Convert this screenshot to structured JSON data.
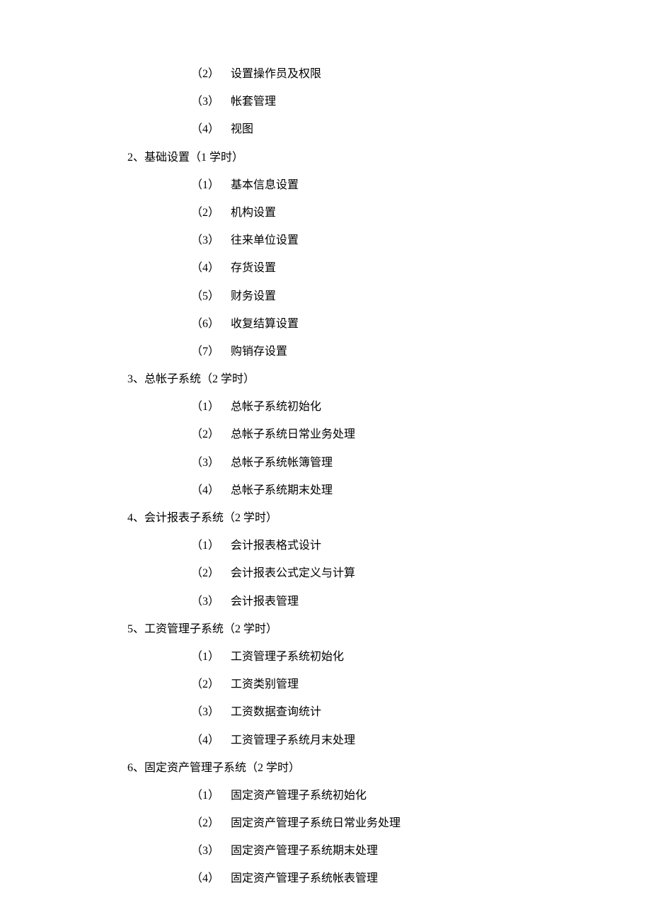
{
  "orphan_items": [
    {
      "num": "（2）",
      "text": "设置操作员及权限"
    },
    {
      "num": "（3）",
      "text": "帐套管理"
    },
    {
      "num": "（4）",
      "text": "视图"
    }
  ],
  "sections": [
    {
      "header": "2、基础设置（1 学时）",
      "items": [
        {
          "num": "（1）",
          "text": "基本信息设置"
        },
        {
          "num": "（2）",
          "text": "机构设置"
        },
        {
          "num": "（3）",
          "text": "往来单位设置"
        },
        {
          "num": "（4）",
          "text": "存货设置"
        },
        {
          "num": "（5）",
          "text": "财务设置"
        },
        {
          "num": "（6）",
          "text": "收复结算设置"
        },
        {
          "num": "（7）",
          "text": "购销存设置"
        }
      ]
    },
    {
      "header": "3、总帐子系统（2 学时）",
      "items": [
        {
          "num": "（1）",
          "text": "总帐子系统初始化"
        },
        {
          "num": "（2）",
          "text": "总帐子系统日常业务处理"
        },
        {
          "num": "（3）",
          "text": "总帐子系统帐簿管理"
        },
        {
          "num": "（4）",
          "text": "总帐子系统期末处理"
        }
      ]
    },
    {
      "header": "4、会计报表子系统（2 学时）",
      "items": [
        {
          "num": "（1）",
          "text": "会计报表格式设计"
        },
        {
          "num": "（2）",
          "text": "会计报表公式定义与计算"
        },
        {
          "num": "（3）",
          "text": "会计报表管理"
        }
      ]
    },
    {
      "header": "5、工资管理子系统（2 学时）",
      "items": [
        {
          "num": "（1）",
          "text": "工资管理子系统初始化"
        },
        {
          "num": "（2）",
          "text": "工资类别管理"
        },
        {
          "num": "（3）",
          "text": "工资数据查询统计"
        },
        {
          "num": "（4）",
          "text": "工资管理子系统月末处理"
        }
      ]
    },
    {
      "header": "6、固定资产管理子系统（2 学时）",
      "items": [
        {
          "num": "（1）",
          "text": "固定资产管理子系统初始化"
        },
        {
          "num": "（2）",
          "text": "固定资产管理子系统日常业务处理"
        },
        {
          "num": "（3）",
          "text": "固定资产管理子系统期末处理"
        },
        {
          "num": "（4）",
          "text": "固定资产管理子系统帐表管理"
        }
      ]
    }
  ]
}
